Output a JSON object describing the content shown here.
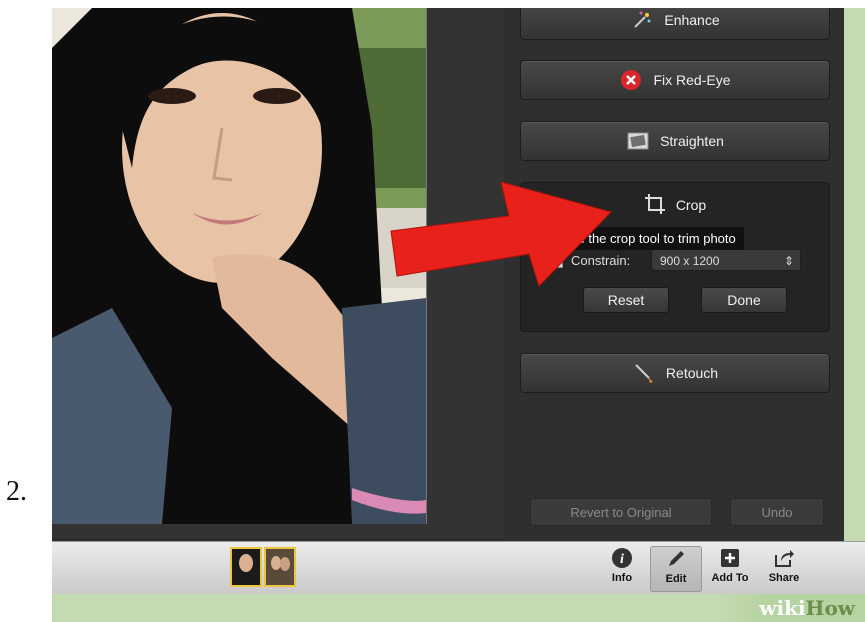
{
  "step_label": "2.",
  "panel": {
    "tools": [
      {
        "label": "Enhance",
        "icon": "magic-wand-icon"
      },
      {
        "label": "Fix Red-Eye",
        "icon": "red-x-icon"
      },
      {
        "label": "Straighten",
        "icon": "straighten-icon"
      },
      {
        "label": "Crop",
        "icon": "crop-icon"
      },
      {
        "label": "Retouch",
        "icon": "brush-icon"
      }
    ],
    "crop": {
      "tooltip": "se the crop tool to trim photo",
      "constrain_label": "Constrain:",
      "dimension_value": "900 x 1200",
      "reset_label": "Reset",
      "done_label": "Done"
    },
    "revert_label": "Revert to Original",
    "undo_label": "Undo"
  },
  "toolbar": {
    "items": [
      {
        "label": "Info",
        "icon": "info-icon"
      },
      {
        "label": "Edit",
        "icon": "pencil-icon"
      },
      {
        "label": "Add To",
        "icon": "plus-icon"
      },
      {
        "label": "Share",
        "icon": "share-icon"
      }
    ],
    "active_item": "Edit"
  },
  "watermark": {
    "part1": "wiki",
    "part2": "How"
  },
  "colors": {
    "panel": "#2f2f2f",
    "arrow": "#e8211b",
    "thumb_border": "#e9c63d",
    "green": "#c4dbb2"
  }
}
